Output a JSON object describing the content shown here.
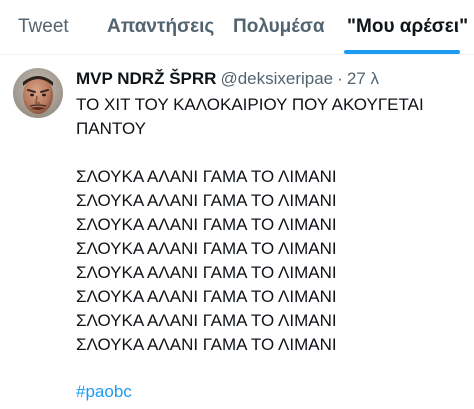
{
  "tabs": [
    {
      "label": "Tweet"
    },
    {
      "label": "Απαντήσεις"
    },
    {
      "label": "Πολυμέσα"
    },
    {
      "label": "\"Μου αρέσει\""
    }
  ],
  "tweet": {
    "display_name": "MVP NDRŽ ŠPRR",
    "handle": "@deksixeripae",
    "separator": "·",
    "time": "27 λ",
    "lines": [
      "ΤΟ ΧΙΤ ΤΟΥ ΚΑΛΟΚΑΙΡΙΟΥ ΠΟΥ ΑΚΟΥΓΕΤΑΙ",
      "ΠΑΝΤΟΥ",
      "ΣΛΟΥΚΑ ΑΛΑΝΙ ΓΑΜΑ ΤΟ ΛΙΜΑΝΙ",
      "ΣΛΟΥΚΑ ΑΛΑΝΙ ΓΑΜΑ ΤΟ ΛΙΜΑΝΙ",
      "ΣΛΟΥΚΑ ΑΛΑΝΙ ΓΑΜΑ ΤΟ ΛΙΜΑΝΙ",
      "ΣΛΟΥΚΑ ΑΛΑΝΙ ΓΑΜΑ ΤΟ ΛΙΜΑΝΙ",
      "ΣΛΟΥΚΑ ΑΛΑΝΙ ΓΑΜΑ ΤΟ ΛΙΜΑΝΙ",
      "ΣΛΟΥΚΑ ΑΛΑΝΙ ΓΑΜΑ ΤΟ ΛΙΜΑΝΙ",
      "ΣΛΟΥΚΑ ΑΛΑΝΙ ΓΑΜΑ ΤΟ ΛΙΜΑΝΙ",
      "ΣΛΟΥΚΑ ΑΛΑΝΙ ΓΑΜΑ ΤΟ ΛΙΜΑΝΙ"
    ],
    "hashtag": "#paobc"
  },
  "colors": {
    "accent": "#1d9bf0",
    "text_primary": "#0f1419",
    "text_secondary": "#536471",
    "divider": "#eff3f4"
  }
}
